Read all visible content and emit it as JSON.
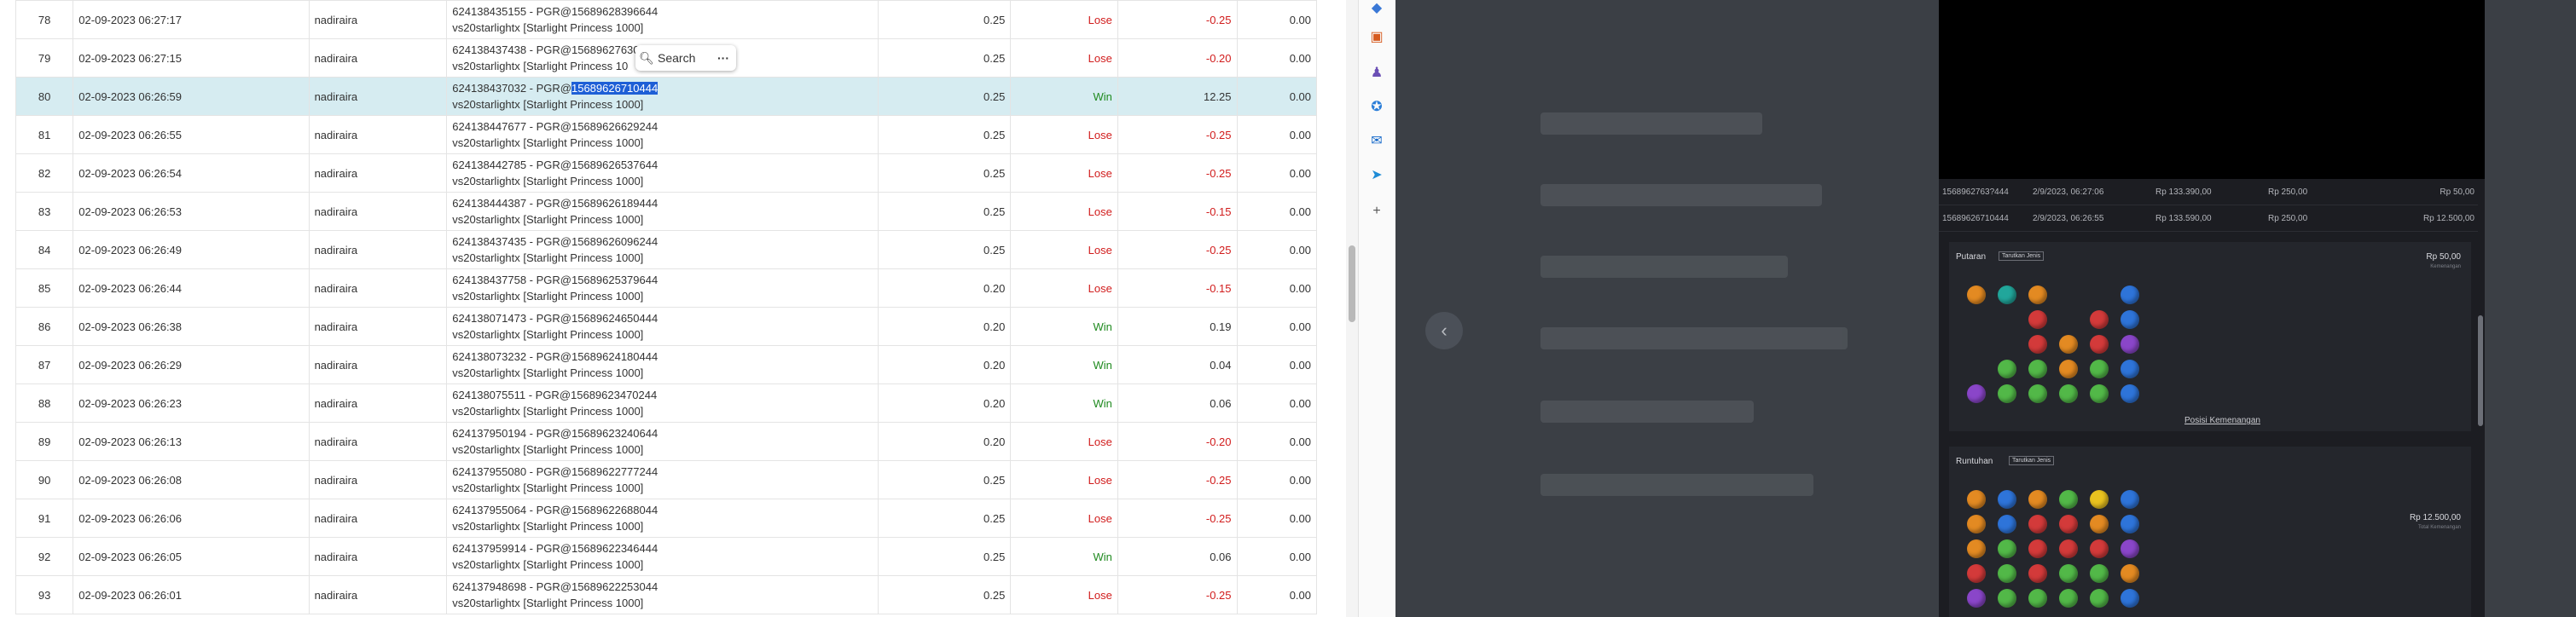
{
  "popup": {
    "search_label": "Search",
    "more_label": "···"
  },
  "rows": [
    {
      "no": "78",
      "date": "02-09-2023 06:27:17",
      "user": "nadiraira",
      "bet_line1": "624138435155 - PGR@15689628396644",
      "bet_line2": "vs20starlightx [Starlight Princess 1000]",
      "amount": "0.25",
      "result": "Lose",
      "win": "-0.25",
      "balance": "0.00"
    },
    {
      "no": "79",
      "date": "02-09-2023 06:27:15",
      "user": "nadiraira",
      "bet_line1": "624138437438 - PGR@15689627630",
      "bet_line2": "vs20starlightx [Starlight Princess 10",
      "amount": "0.25",
      "result": "Lose",
      "win": "-0.20",
      "balance": "0.00"
    },
    {
      "no": "80",
      "date": "02-09-2023 06:26:59",
      "user": "nadiraira",
      "bet_prefix": "624138437032 - PGR@",
      "bet_selected": "15689626710444",
      "bet_line2": "vs20starlightx [Starlight Princess 1000]",
      "amount": "0.25",
      "result": "Win",
      "win": "12.25",
      "balance": "0.00"
    },
    {
      "no": "81",
      "date": "02-09-2023 06:26:55",
      "user": "nadiraira",
      "bet_line1": "624138447677 - PGR@15689626629244",
      "bet_line2": "vs20starlightx [Starlight Princess 1000]",
      "amount": "0.25",
      "result": "Lose",
      "win": "-0.25",
      "balance": "0.00"
    },
    {
      "no": "82",
      "date": "02-09-2023 06:26:54",
      "user": "nadiraira",
      "bet_line1": "624138442785 - PGR@15689626537644",
      "bet_line2": "vs20starlightx [Starlight Princess 1000]",
      "amount": "0.25",
      "result": "Lose",
      "win": "-0.25",
      "balance": "0.00"
    },
    {
      "no": "83",
      "date": "02-09-2023 06:26:53",
      "user": "nadiraira",
      "bet_line1": "624138444387 - PGR@15689626189444",
      "bet_line2": "vs20starlightx [Starlight Princess 1000]",
      "amount": "0.25",
      "result": "Lose",
      "win": "-0.15",
      "balance": "0.00"
    },
    {
      "no": "84",
      "date": "02-09-2023 06:26:49",
      "user": "nadiraira",
      "bet_line1": "624138437435 - PGR@15689626096244",
      "bet_line2": "vs20starlightx [Starlight Princess 1000]",
      "amount": "0.25",
      "result": "Lose",
      "win": "-0.25",
      "balance": "0.00"
    },
    {
      "no": "85",
      "date": "02-09-2023 06:26:44",
      "user": "nadiraira",
      "bet_line1": "624138437758 - PGR@15689625379644",
      "bet_line2": "vs20starlightx [Starlight Princess 1000]",
      "amount": "0.20",
      "result": "Lose",
      "win": "-0.15",
      "balance": "0.00"
    },
    {
      "no": "86",
      "date": "02-09-2023 06:26:38",
      "user": "nadiraira",
      "bet_line1": "624138071473 - PGR@15689624650444",
      "bet_line2": "vs20starlightx [Starlight Princess 1000]",
      "amount": "0.20",
      "result": "Win",
      "win": "0.19",
      "balance": "0.00"
    },
    {
      "no": "87",
      "date": "02-09-2023 06:26:29",
      "user": "nadiraira",
      "bet_line1": "624138073232 - PGR@15689624180444",
      "bet_line2": "vs20starlightx [Starlight Princess 1000]",
      "amount": "0.20",
      "result": "Win",
      "win": "0.04",
      "balance": "0.00"
    },
    {
      "no": "88",
      "date": "02-09-2023 06:26:23",
      "user": "nadiraira",
      "bet_line1": "624138075511 - PGR@15689623470244",
      "bet_line2": "vs20starlightx [Starlight Princess 1000]",
      "amount": "0.20",
      "result": "Win",
      "win": "0.06",
      "balance": "0.00"
    },
    {
      "no": "89",
      "date": "02-09-2023 06:26:13",
      "user": "nadiraira",
      "bet_line1": "624137950194 - PGR@15689623240644",
      "bet_line2": "vs20starlightx [Starlight Princess 1000]",
      "amount": "0.20",
      "result": "Lose",
      "win": "-0.20",
      "balance": "0.00"
    },
    {
      "no": "90",
      "date": "02-09-2023 06:26:08",
      "user": "nadiraira",
      "bet_line1": "624137955080 - PGR@15689622777244",
      "bet_line2": "vs20starlightx [Starlight Princess 1000]",
      "amount": "0.25",
      "result": "Lose",
      "win": "-0.25",
      "balance": "0.00"
    },
    {
      "no": "91",
      "date": "02-09-2023 06:26:06",
      "user": "nadiraira",
      "bet_line1": "624137955064 - PGR@15689622688044",
      "bet_line2": "vs20starlightx [Starlight Princess 1000]",
      "amount": "0.25",
      "result": "Lose",
      "win": "-0.25",
      "balance": "0.00"
    },
    {
      "no": "92",
      "date": "02-09-2023 06:26:05",
      "user": "nadiraira",
      "bet_line1": "624137959914 - PGR@15689622346444",
      "bet_line2": "vs20starlightx [Starlight Princess 1000]",
      "amount": "0.25",
      "result": "Win",
      "win": "0.06",
      "balance": "0.00"
    },
    {
      "no": "93",
      "date": "02-09-2023 06:26:01",
      "user": "nadiraira",
      "bet_line1": "624137948698 - PGR@15689622253044",
      "bet_line2": "vs20starlightx [Starlight Princess 1000]",
      "amount": "0.25",
      "result": "Lose",
      "win": "-0.25",
      "balance": "0.00"
    }
  ],
  "colors": {
    "win": "#1f8a1f",
    "lose": "#d11c1c",
    "highlight_row": "#d6ecf1",
    "selection": "#1e5fd6"
  },
  "sidebar_icons": [
    "tag-icon",
    "toolbox-icon",
    "people-icon",
    "copilot-icon",
    "outlook-icon",
    "send-icon",
    "plus-icon"
  ],
  "game": {
    "history": [
      {
        "id": "1568962763?444",
        "date": "2/9/2023, 06:27:06",
        "balance": "Rp 133.390,00",
        "bet": "Rp 250,00",
        "win": "Rp 50,00"
      },
      {
        "id": "15689626710444",
        "date": "2/9/2023, 06:26:55",
        "balance": "Rp 133.590,00",
        "bet": "Rp 250,00",
        "win": "Rp 12.500,00"
      }
    ],
    "card1": {
      "title": "Putaran",
      "tag": "Tarutkan Jenis",
      "amount": "Rp 50,00",
      "sub": "Kemenangan",
      "link": "Posisi Kemenangan",
      "gems": [
        "orange",
        "teal",
        "orange",
        "empty",
        "empty",
        "blue",
        "empty",
        "empty",
        "red",
        "empty",
        "red",
        "blue",
        "empty",
        "empty",
        "red",
        "orange",
        "red",
        "purple",
        "empty",
        "green",
        "green",
        "orange",
        "green",
        "blue",
        "purple",
        "green",
        "green",
        "green",
        "green",
        "blue"
      ]
    },
    "card2": {
      "title": "Runtuhan",
      "tag": "Tarutkan Jenis",
      "amount": "Rp 12.500,00",
      "sub": "Total Kemenangan",
      "gems": [
        "orange",
        "blue",
        "orange",
        "green",
        "yellow",
        "blue",
        "orange",
        "blue",
        "red",
        "red",
        "orange",
        "blue",
        "orange",
        "green",
        "red",
        "red",
        "red",
        "purple",
        "red",
        "green",
        "red",
        "green",
        "green",
        "orange",
        "purple",
        "green",
        "green",
        "green",
        "green",
        "blue"
      ]
    }
  }
}
